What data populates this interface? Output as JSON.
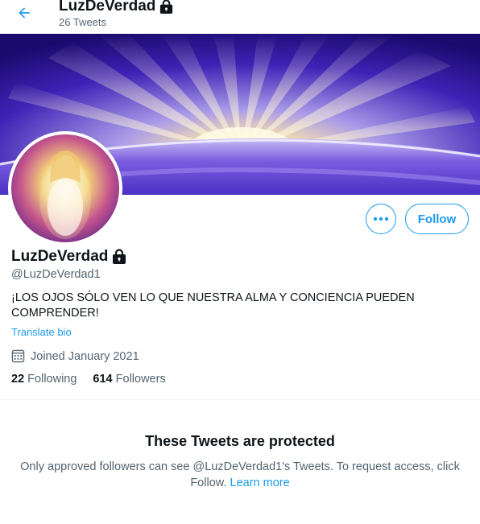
{
  "header": {
    "display_name": "LuzDeVerdad",
    "tweet_count": "26 Tweets",
    "back_icon": "arrow-left-icon",
    "lock_icon": "lock-icon"
  },
  "profile": {
    "display_name": "LuzDeVerdad",
    "handle": "@LuzDeVerdad1",
    "bio": "¡LOS OJOS SÓLO VEN LO QUE NUESTRA ALMA Y CONCIENCIA PUEDEN COMPRENDER!",
    "translate_label": "Translate bio",
    "joined": "Joined January 2021",
    "following_count": "22",
    "following_label": "Following",
    "followers_count": "614",
    "followers_label": "Followers"
  },
  "actions": {
    "follow_label": "Follow",
    "more_icon": "more-horizontal-icon"
  },
  "protected": {
    "title": "These Tweets are protected",
    "message": "Only approved followers can see @LuzDeVerdad1's Tweets. To request access, click Follow.",
    "learn_more": "Learn more"
  },
  "colors": {
    "accent": "#1d9bf0",
    "text_primary": "#0f1419",
    "text_secondary": "#536471"
  }
}
